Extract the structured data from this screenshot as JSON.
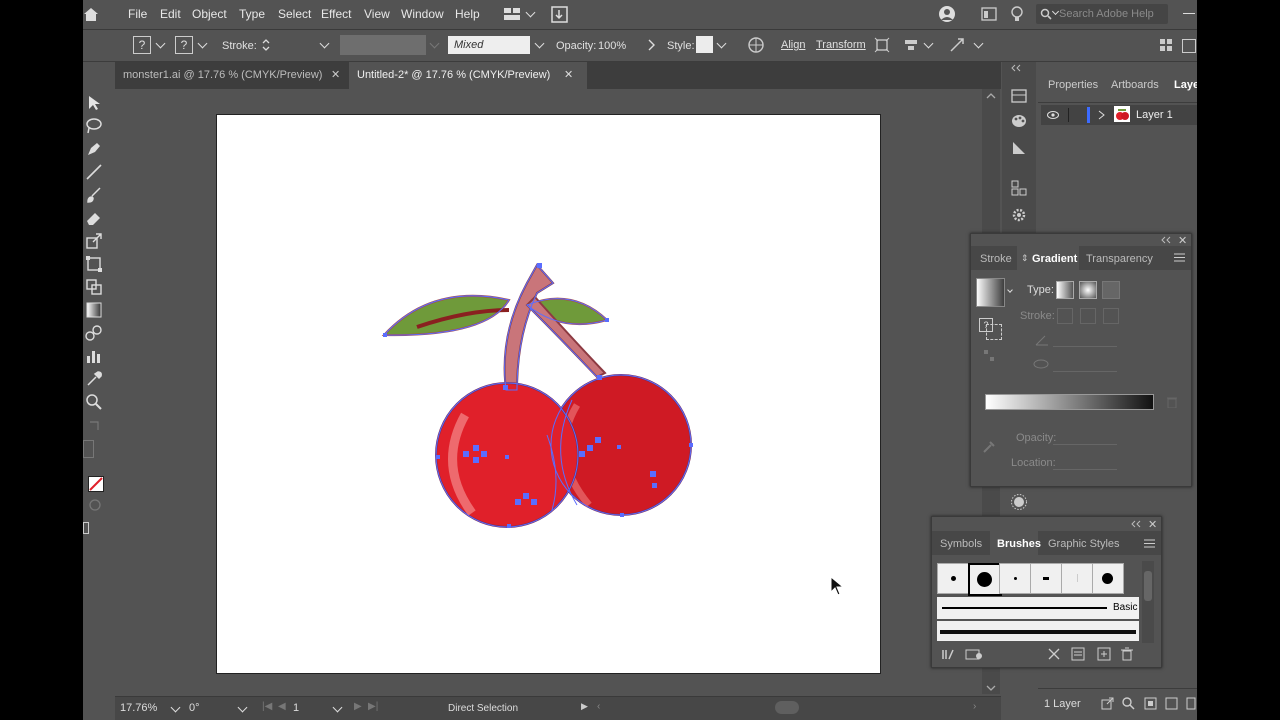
{
  "menu": [
    "File",
    "Edit",
    "Object",
    "Type",
    "Select",
    "Effect",
    "View",
    "Window",
    "Help"
  ],
  "search_placeholder": "Search Adobe Help",
  "control": {
    "fill_glyph": "?",
    "stroke_glyph": "?",
    "stroke_label": "Stroke:",
    "blend_mode": "Mixed",
    "opacity_label": "Opacity:",
    "opacity_value": "100%",
    "style_label": "Style:",
    "align_label": "Align",
    "transform_label": "Transform"
  },
  "tabs": [
    {
      "label": "monster1.ai @ 17.76 % (CMYK/Preview)",
      "active": false
    },
    {
      "label": "Untitled-2* @ 17.76 % (CMYK/Preview)",
      "active": true
    }
  ],
  "close_glyph": "✕",
  "status": {
    "zoom": "17.76%",
    "rotation": "0°",
    "artboard_num": "1",
    "tool_name": "Direct Selection"
  },
  "layers_panel": {
    "tabs": [
      "Properties",
      "Artboards",
      "Layer"
    ],
    "layer_name": "Layer 1",
    "footer": "1 Layer"
  },
  "gradient_panel": {
    "tabs": [
      "Stroke",
      "Gradient",
      "Transparency"
    ],
    "type_label": "Type:",
    "stroke_label": "Stroke:",
    "opacity_label": "Opacity:",
    "location_label": "Location:"
  },
  "brushes_panel": {
    "tabs": [
      "Symbols",
      "Brushes",
      "Graphic Styles"
    ],
    "basic_label": "Basic"
  },
  "colors": {
    "ui_bg": "#535353",
    "dark_bg": "#3d3d3d",
    "cherry_red": "#e0202a",
    "leaf_green": "#6f9a3a",
    "stem": "#c9757a",
    "selection_blue": "#5a6dff"
  }
}
